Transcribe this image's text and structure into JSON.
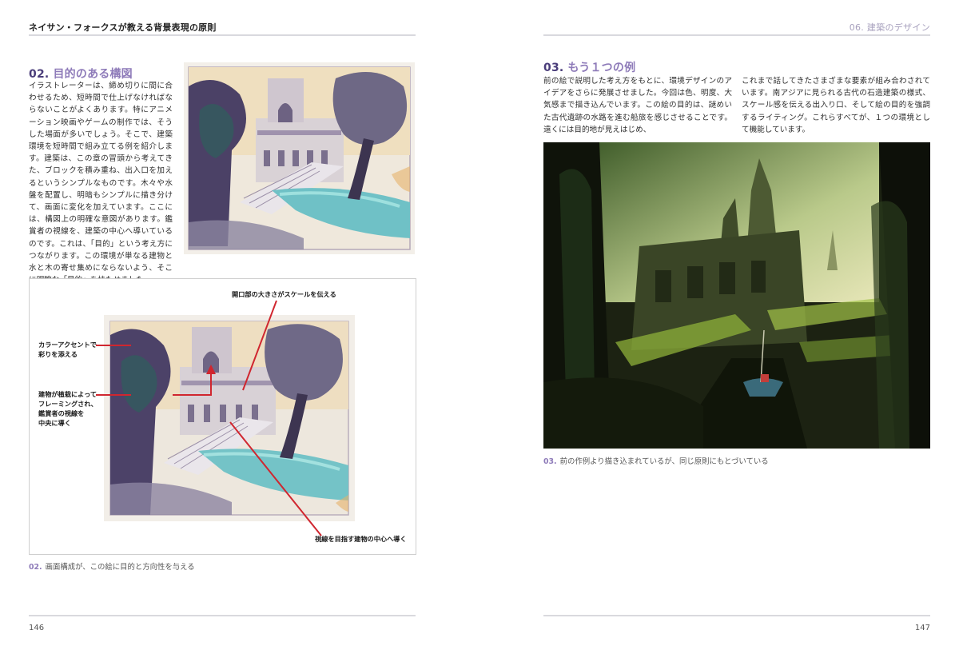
{
  "header": {
    "left_title": "ネイサン・フォークスが教える背景表現の原則",
    "right_title": "06. 建築のデザイン"
  },
  "section_02": {
    "number": "02.",
    "title": "目的のある構図",
    "paragraph": "イラストレーターは、締め切りに間に合わせるため、短時間で仕上げなければならないことがよくあります。特にアニメーション映画やゲームの制作では、そうした場面が多いでしょう。そこで、建築環境を短時間で組み立てる例を紹介します。建築は、この章の冒頭から考えてきた、ブロックを積み重ね、出入口を加えるというシンプルなものです。木々や水盤を配置し、明暗もシンプルに描き分けて、画面に変化を加えています。ここには、構図上の明確な意図があります。鑑賞者の視線を、建築の中心へ導いているのです。これは、「目的」という考え方につながります。この環境が単なる建物と水と木の寄せ集めにならないよう、そこに明瞭な「目的」を持たせました。"
  },
  "annotations": {
    "opening": "開口部の大きさがスケールを伝える",
    "color_accent": "カラーアクセントで\n彩りを添える",
    "framing": "建物が植栽によって\nフレーミングされ、\n鑑賞者の視線を\n中央に導く",
    "guide": "視線を目指す建物の中心へ導く"
  },
  "caption_02": {
    "number": "02.",
    "text": "画面構成が、この絵に目的と方向性を与える"
  },
  "section_03": {
    "number": "03.",
    "title": "もう１つの例",
    "col1": "前の絵で説明した考え方をもとに、環境デザインのアイデアをさらに発展させました。今回は色、明度、大気感まで描き込んでいます。この絵の目的は、謎めいた古代遺跡の水路を進む船旅を感じさせることです。遠くには目的地が見えはじめ、",
    "col2": "これまで話してきたさまざまな要素が組み合わされています。南アジアに見られる古代の石造建築の様式、スケール感を伝える出入り口、そして絵の目的を強調するライティング。これらすべてが、１つの環境として機能しています。"
  },
  "caption_03": {
    "number": "03.",
    "text": "前の作例より描き込まれているが、同じ原則にもとづいている"
  },
  "page_numbers": {
    "left": "146",
    "right": "147"
  },
  "colors": {
    "accent_purple": "#8e7bb9",
    "dark_purple": "#4a3d7a",
    "annotation_red": "#d0262f"
  }
}
